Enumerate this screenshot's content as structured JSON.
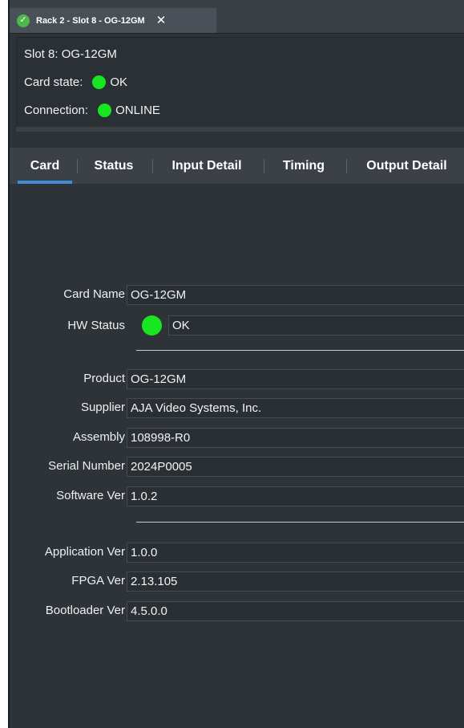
{
  "tab": {
    "title": "Rack 2 - Slot 8 - OG-12GM",
    "close_glyph": "✕",
    "status_icon": "check-circle-icon"
  },
  "info": {
    "slot": "Slot 8: OG-12GM",
    "card_state_label": "Card state:",
    "card_state_value": "OK",
    "connection_label": "Connection:",
    "connection_value": "ONLINE"
  },
  "page_tabs": [
    "Card",
    "Status",
    "Input Detail",
    "Timing",
    "Output Detail"
  ],
  "active_tab": "Card",
  "fields": {
    "card_name": {
      "label": "Card Name",
      "value": "OG-12GM"
    },
    "hw_status": {
      "label": "HW Status",
      "value": "OK"
    },
    "product": {
      "label": "Product",
      "value": "OG-12GM"
    },
    "supplier": {
      "label": "Supplier",
      "value": "AJA Video Systems, Inc."
    },
    "assembly": {
      "label": "Assembly",
      "value": "108998-R0"
    },
    "serial": {
      "label": "Serial Number",
      "value": "2024P0005"
    },
    "software": {
      "label": "Software Ver",
      "value": "1.0.2"
    },
    "application": {
      "label": "Application Ver",
      "value": "1.0.0"
    },
    "fpga": {
      "label": "FPGA Ver",
      "value": "2.13.105"
    },
    "bootloader": {
      "label": "Bootloader Ver",
      "value": "4.5.0.0"
    }
  },
  "colors": {
    "ok_green": "#18e620",
    "accent_blue": "#3d8fd6",
    "panel_bg": "#2e3338"
  }
}
